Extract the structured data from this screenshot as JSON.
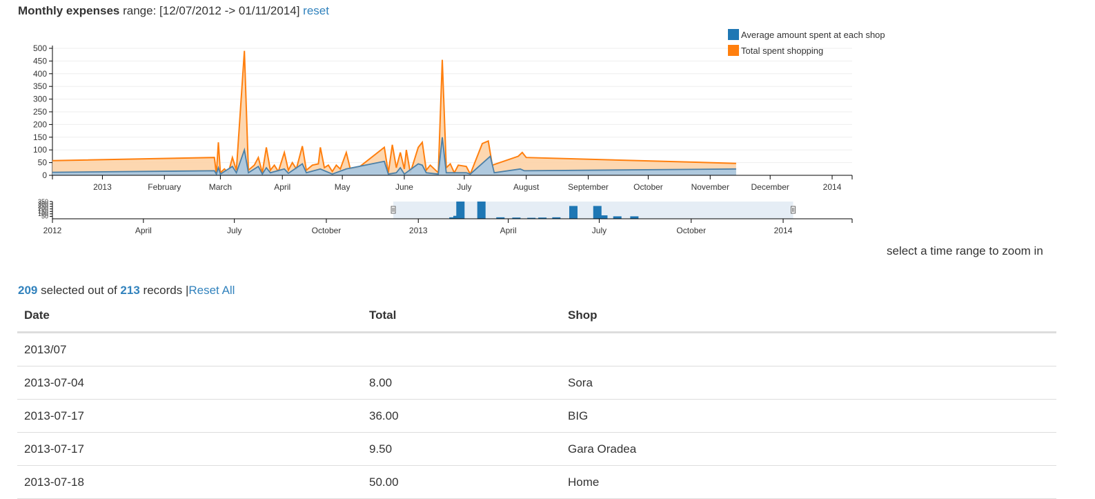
{
  "header": {
    "title": "Monthly expenses",
    "range_label": "range:",
    "range_value": "[12/07/2012 -> 01/11/2014]",
    "reset": "reset"
  },
  "legend": [
    {
      "label": "Average amount spent at each shop",
      "color": "#1f77b4"
    },
    {
      "label": "Total spent shopping",
      "color": "#ff7f0e"
    }
  ],
  "chart_data": [
    {
      "type": "area",
      "ylim": [
        0,
        500
      ],
      "yticks": [
        0,
        50,
        100,
        150,
        200,
        250,
        300,
        350,
        400,
        450,
        500
      ],
      "xlim": [
        "2012-12-07",
        "2014-01-11"
      ],
      "xticks": [
        {
          "d": "2013-01-01",
          "label": "2013"
        },
        {
          "d": "2013-02-01",
          "label": "February"
        },
        {
          "d": "2013-03-01",
          "label": "March"
        },
        {
          "d": "2013-04-01",
          "label": "April"
        },
        {
          "d": "2013-05-01",
          "label": "May"
        },
        {
          "d": "2013-06-01",
          "label": "June"
        },
        {
          "d": "2013-07-01",
          "label": "July"
        },
        {
          "d": "2013-08-01",
          "label": "August"
        },
        {
          "d": "2013-09-01",
          "label": "September"
        },
        {
          "d": "2013-10-01",
          "label": "October"
        },
        {
          "d": "2013-11-01",
          "label": "November"
        },
        {
          "d": "2013-12-01",
          "label": "December"
        },
        {
          "d": "2014-01-01",
          "label": "2014"
        }
      ],
      "series": [
        {
          "name": "Total spent shopping",
          "color": "#ff7f0e",
          "points": [
            [
              "2012-12-07",
              58
            ],
            [
              "2013-02-26",
              70
            ],
            [
              "2013-02-27",
              5
            ],
            [
              "2013-02-28",
              130
            ],
            [
              "2013-03-01",
              10
            ],
            [
              "2013-03-03",
              25
            ],
            [
              "2013-03-05",
              10
            ],
            [
              "2013-03-07",
              70
            ],
            [
              "2013-03-09",
              20
            ],
            [
              "2013-03-13",
              490
            ],
            [
              "2013-03-15",
              20
            ],
            [
              "2013-03-18",
              40
            ],
            [
              "2013-03-20",
              70
            ],
            [
              "2013-03-22",
              10
            ],
            [
              "2013-03-24",
              110
            ],
            [
              "2013-03-26",
              20
            ],
            [
              "2013-03-28",
              40
            ],
            [
              "2013-03-30",
              15
            ],
            [
              "2013-04-02",
              90
            ],
            [
              "2013-04-04",
              20
            ],
            [
              "2013-04-06",
              50
            ],
            [
              "2013-04-08",
              25
            ],
            [
              "2013-04-11",
              115
            ],
            [
              "2013-04-13",
              20
            ],
            [
              "2013-04-16",
              40
            ],
            [
              "2013-04-19",
              45
            ],
            [
              "2013-04-20",
              110
            ],
            [
              "2013-04-22",
              30
            ],
            [
              "2013-04-24",
              40
            ],
            [
              "2013-04-26",
              15
            ],
            [
              "2013-04-28",
              40
            ],
            [
              "2013-04-30",
              25
            ],
            [
              "2013-05-03",
              90
            ],
            [
              "2013-05-05",
              25
            ],
            [
              "2013-05-09",
              30
            ],
            [
              "2013-05-22",
              110
            ],
            [
              "2013-05-24",
              10
            ],
            [
              "2013-05-26",
              120
            ],
            [
              "2013-05-28",
              30
            ],
            [
              "2013-05-30",
              90
            ],
            [
              "2013-06-01",
              25
            ],
            [
              "2013-06-02",
              100
            ],
            [
              "2013-06-04",
              10
            ],
            [
              "2013-06-08",
              110
            ],
            [
              "2013-06-10",
              130
            ],
            [
              "2013-06-12",
              20
            ],
            [
              "2013-06-14",
              40
            ],
            [
              "2013-06-18",
              10
            ],
            [
              "2013-06-20",
              455
            ],
            [
              "2013-06-22",
              30
            ],
            [
              "2013-06-24",
              45
            ],
            [
              "2013-06-26",
              10
            ],
            [
              "2013-06-28",
              40
            ],
            [
              "2013-07-02",
              35
            ],
            [
              "2013-07-04",
              5
            ],
            [
              "2013-07-10",
              125
            ],
            [
              "2013-07-13",
              135
            ],
            [
              "2013-07-15",
              40
            ],
            [
              "2013-07-28",
              75
            ],
            [
              "2013-07-30",
              90
            ],
            [
              "2013-08-01",
              70
            ],
            [
              "2013-11-14",
              47
            ]
          ]
        },
        {
          "name": "Average amount spent at each shop",
          "color": "#1f77b4",
          "points": [
            [
              "2012-12-07",
              12
            ],
            [
              "2013-02-26",
              18
            ],
            [
              "2013-02-27",
              5
            ],
            [
              "2013-02-28",
              30
            ],
            [
              "2013-03-01",
              5
            ],
            [
              "2013-03-07",
              35
            ],
            [
              "2013-03-09",
              10
            ],
            [
              "2013-03-13",
              100
            ],
            [
              "2013-03-15",
              10
            ],
            [
              "2013-03-20",
              35
            ],
            [
              "2013-03-22",
              5
            ],
            [
              "2013-03-24",
              30
            ],
            [
              "2013-03-26",
              10
            ],
            [
              "2013-04-02",
              25
            ],
            [
              "2013-04-04",
              8
            ],
            [
              "2013-04-11",
              45
            ],
            [
              "2013-04-13",
              10
            ],
            [
              "2013-04-20",
              25
            ],
            [
              "2013-04-26",
              5
            ],
            [
              "2013-05-03",
              25
            ],
            [
              "2013-05-22",
              55
            ],
            [
              "2013-05-24",
              5
            ],
            [
              "2013-05-28",
              10
            ],
            [
              "2013-05-30",
              30
            ],
            [
              "2013-06-01",
              5
            ],
            [
              "2013-06-08",
              45
            ],
            [
              "2013-06-10",
              40
            ],
            [
              "2013-06-12",
              10
            ],
            [
              "2013-06-18",
              5
            ],
            [
              "2013-06-20",
              150
            ],
            [
              "2013-06-22",
              10
            ],
            [
              "2013-06-28",
              10
            ],
            [
              "2013-07-02",
              10
            ],
            [
              "2013-07-04",
              5
            ],
            [
              "2013-07-14",
              75
            ],
            [
              "2013-07-16",
              10
            ],
            [
              "2013-07-29",
              25
            ],
            [
              "2013-07-31",
              18
            ],
            [
              "2013-11-14",
              25
            ]
          ]
        }
      ]
    },
    {
      "type": "bar",
      "xlim": [
        "2012-01-01",
        "2014-03-11"
      ],
      "yticks": [
        50,
        100,
        150,
        200,
        250,
        300,
        350
      ],
      "brush": [
        "2012-12-07",
        "2014-01-11"
      ],
      "xticks": [
        {
          "d": "2012-01-01",
          "label": "2012"
        },
        {
          "d": "2012-04-01",
          "label": "April"
        },
        {
          "d": "2012-07-01",
          "label": "July"
        },
        {
          "d": "2012-10-01",
          "label": "October"
        },
        {
          "d": "2013-01-01",
          "label": "2013"
        },
        {
          "d": "2013-04-01",
          "label": "April"
        },
        {
          "d": "2013-07-01",
          "label": "July"
        },
        {
          "d": "2013-10-01",
          "label": "October"
        },
        {
          "d": "2014-01-01",
          "label": "2014"
        }
      ],
      "bars": [
        [
          "2012-05-01",
          4
        ],
        [
          "2012-06-01",
          4
        ],
        [
          "2013-02-01",
          30
        ],
        [
          "2013-02-05",
          60
        ],
        [
          "2013-02-08",
          350
        ],
        [
          "2013-03-01",
          350
        ],
        [
          "2013-03-20",
          30
        ],
        [
          "2013-04-05",
          25
        ],
        [
          "2013-04-20",
          20
        ],
        [
          "2013-05-01",
          25
        ],
        [
          "2013-05-15",
          30
        ],
        [
          "2013-06-01",
          260
        ],
        [
          "2013-06-25",
          260
        ],
        [
          "2013-07-01",
          70
        ],
        [
          "2013-07-15",
          50
        ],
        [
          "2013-08-01",
          50
        ],
        [
          "2013-11-01",
          6
        ],
        [
          "2013-11-15",
          6
        ]
      ]
    }
  ],
  "zoom_hint": "select a time range to zoom in",
  "counts": {
    "selected": "209",
    "text1": "selected out of",
    "total": "213",
    "text2": "records",
    "sep": "|",
    "reset_all": "Reset All"
  },
  "table": {
    "headers": [
      "Date",
      "Total",
      "Shop"
    ],
    "rows": [
      [
        "2013/07",
        "",
        ""
      ],
      [
        "2013-07-04",
        "8.00",
        "Sora"
      ],
      [
        "2013-07-17",
        "36.00",
        "BIG"
      ],
      [
        "2013-07-17",
        "9.50",
        "Gara Oradea"
      ],
      [
        "2013-07-18",
        "50.00",
        "Home"
      ]
    ]
  }
}
